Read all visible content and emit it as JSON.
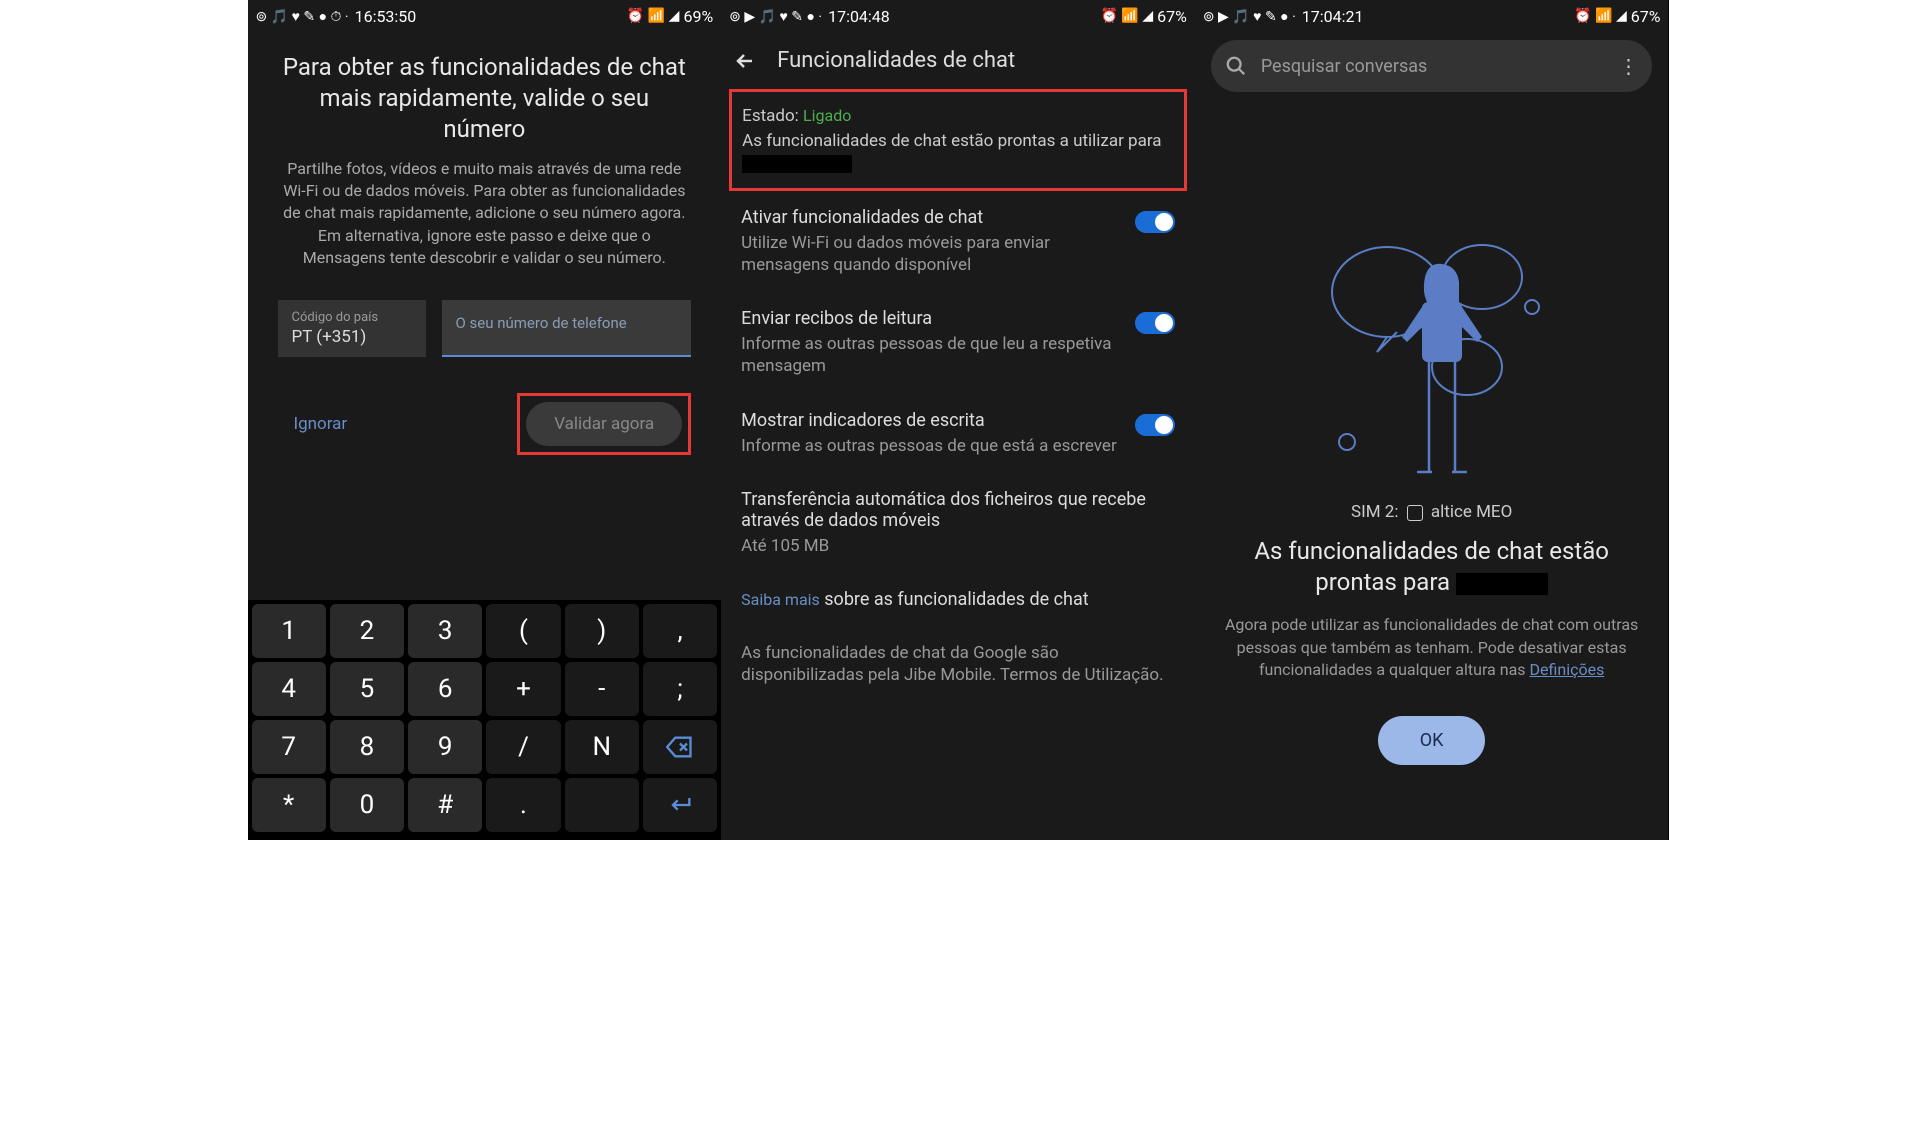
{
  "screen1": {
    "status": {
      "time": "16:53:50",
      "battery": "69%"
    },
    "title": "Para obter as funcionalidades de chat mais rapidamente, valide o seu número",
    "desc": "Partilhe fotos, vídeos e muito mais através de uma rede Wi-Fi ou de dados móveis. Para obter as funcionalidades de chat mais rapidamente, adicione o seu número agora. Em alternativa, ignore este passo e deixe que o Mensagens tente descobrir e validar o seu número.",
    "country_label": "Código do país",
    "country_value": "PT (+351)",
    "phone_placeholder": "O seu número de telefone",
    "ignore": "Ignorar",
    "validate": "Validar agora",
    "keypad": [
      [
        "1",
        "2",
        "3",
        "(",
        ")",
        ","
      ],
      [
        "4",
        "5",
        "6",
        "+",
        "-",
        ";"
      ],
      [
        "7",
        "8",
        "9",
        "/",
        "N",
        "BKSP"
      ],
      [
        "*",
        "0",
        "#",
        ".",
        "",
        "ENTER"
      ]
    ]
  },
  "screen2": {
    "status": {
      "time": "17:04:48",
      "battery": "67%"
    },
    "title": "Funcionalidades de chat",
    "status_label": "Estado: ",
    "status_value": "Ligado",
    "status_desc": "As funcionalidades de chat estão prontas a utilizar para ",
    "items": [
      {
        "title": "Ativar funcionalidades de chat",
        "desc": "Utilize Wi-Fi ou dados móveis para enviar mensagens quando disponível",
        "toggle": true
      },
      {
        "title": "Enviar recibos de leitura",
        "desc": "Informe as outras pessoas de que leu a respetiva mensagem",
        "toggle": true
      },
      {
        "title": "Mostrar indicadores de escrita",
        "desc": "Informe as outras pessoas de que está a escrever",
        "toggle": true
      },
      {
        "title": "Transferência automática dos ficheiros que recebe através de dados móveis",
        "desc": "Até 105 MB",
        "toggle": false
      }
    ],
    "learn_more_link": "Saiba mais",
    "learn_more_rest": " sobre as funcionalidades de chat",
    "footer": "As funcionalidades de chat da Google são disponibilizadas pela Jibe Mobile. Termos de Utilização."
  },
  "screen3": {
    "status": {
      "time": "17:04:21",
      "battery": "67%"
    },
    "search_placeholder": "Pesquisar conversas",
    "sim_label": "SIM 2:",
    "sim_carrier": "altice MEO",
    "heading_prefix": "As funcionalidades de chat estão prontas para ",
    "body_prefix": "Agora pode utilizar as funcionalidades de chat com outras pessoas que também as tenham. Pode desativar estas funcionalidades a qualquer altura nas ",
    "body_link": "Definições",
    "ok": "OK"
  }
}
